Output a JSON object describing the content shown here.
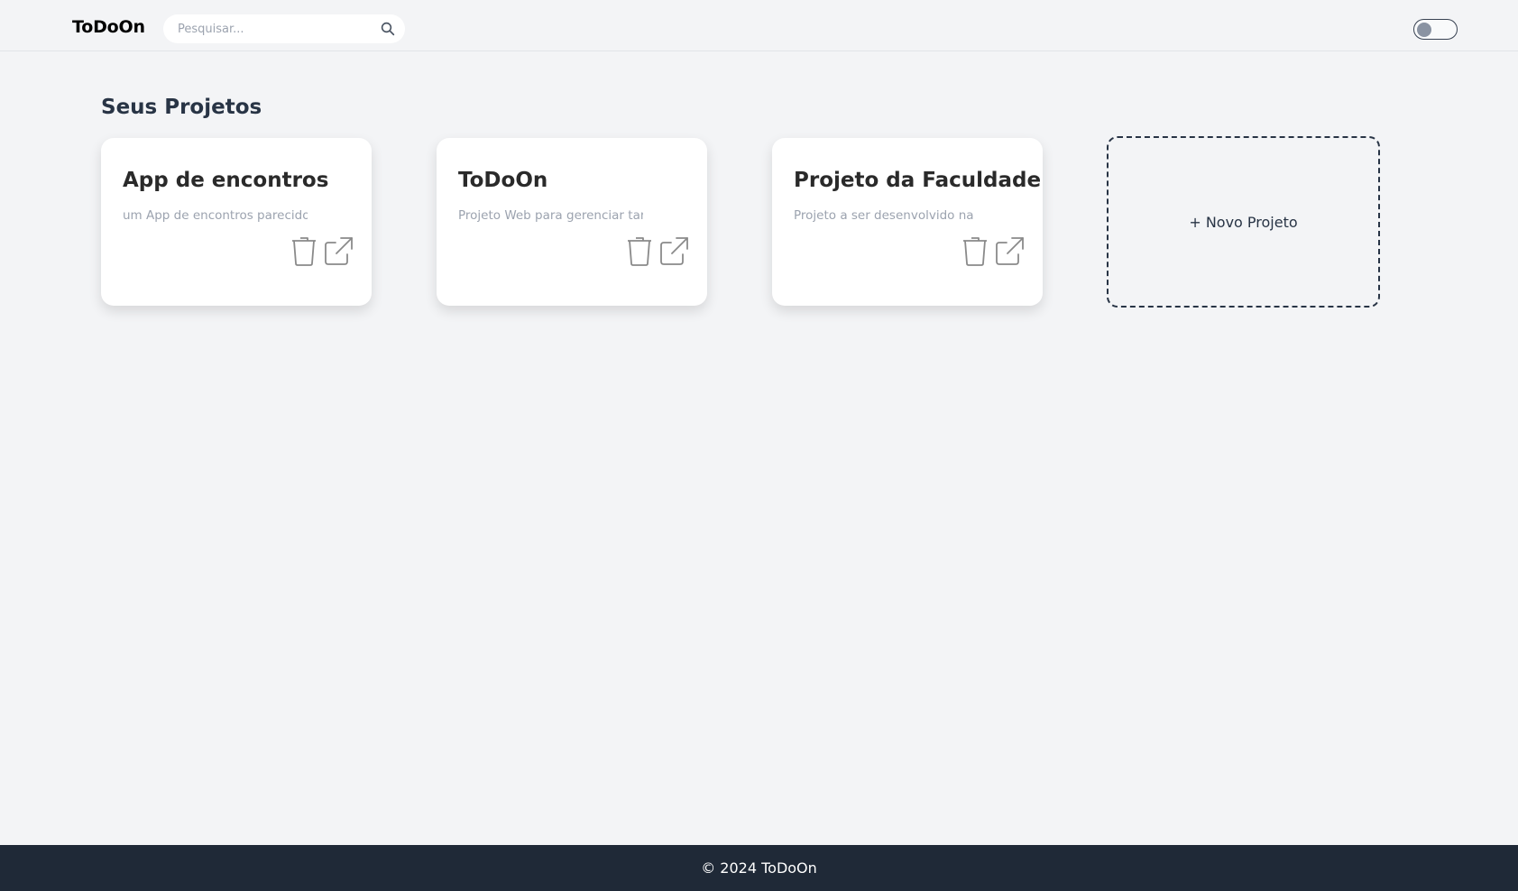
{
  "header": {
    "brand": "ToDoOn",
    "search": {
      "placeholder": "Pesquisar...",
      "value": ""
    },
    "theme_toggle": {
      "on": false
    }
  },
  "main": {
    "title": "Seus Projetos",
    "projects": [
      {
        "title": "App de encontros",
        "description": "um App de encontros parecido c"
      },
      {
        "title": "ToDoOn",
        "description": "Projeto Web para gerenciar tar"
      },
      {
        "title": "Projeto da Faculdade",
        "description": "Projeto a ser desenvolvido na"
      }
    ],
    "new_project_label": "+ Novo Projeto"
  },
  "footer": {
    "text": "© 2024 ToDoOn"
  },
  "colors": {
    "background": "#f3f4f6",
    "footer_bg": "#1f2937",
    "heading": "#283445",
    "muted_text": "#9ca3af"
  }
}
